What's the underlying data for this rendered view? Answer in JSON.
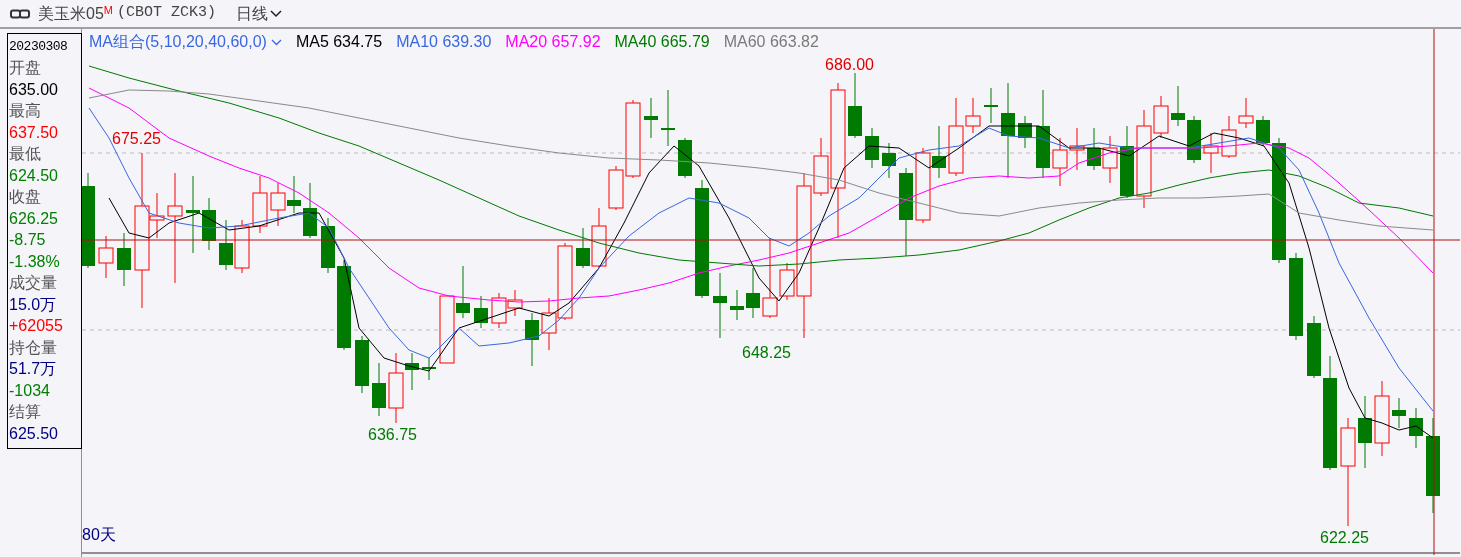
{
  "header": {
    "title": "美玉米05",
    "title_mark": "M",
    "code": "(CBOT ZCK3)",
    "period": "日线"
  },
  "info_panel": {
    "date": "20230308",
    "items": [
      {
        "kind": "label",
        "text": "开盘"
      },
      {
        "kind": "value",
        "text": "635.00",
        "color": "#000000"
      },
      {
        "kind": "label",
        "text": "最高"
      },
      {
        "kind": "value",
        "text": "637.50",
        "color": "#ff0000"
      },
      {
        "kind": "label",
        "text": "最低"
      },
      {
        "kind": "value",
        "text": "624.50",
        "color": "#008000"
      },
      {
        "kind": "label",
        "text": "收盘"
      },
      {
        "kind": "value",
        "text": "626.25",
        "color": "#008000"
      },
      {
        "kind": "value",
        "text": "-8.75",
        "color": "#008000"
      },
      {
        "kind": "value",
        "text": "-1.38%",
        "color": "#008000"
      },
      {
        "kind": "label",
        "text": "成交量"
      },
      {
        "kind": "value",
        "text": "15.0万",
        "color": "#000080"
      },
      {
        "kind": "value",
        "text": "+62055",
        "color": "#ff0000"
      },
      {
        "kind": "label",
        "text": "持仓量"
      },
      {
        "kind": "value",
        "text": "51.7万",
        "color": "#000080"
      },
      {
        "kind": "value",
        "text": "-1034",
        "color": "#008000"
      },
      {
        "kind": "label",
        "text": "结算"
      },
      {
        "kind": "value",
        "text": "625.50",
        "color": "#000080"
      }
    ]
  },
  "indicator_bar": {
    "name": "MA组合(5,10,20,40,60,0)",
    "lines": [
      {
        "label": "MA5 634.75",
        "color": "#000000"
      },
      {
        "label": "MA10 639.30",
        "color": "#3a67e0"
      },
      {
        "label": "MA20 657.92",
        "color": "#ff00ff"
      },
      {
        "label": "MA40 665.79",
        "color": "#007a00"
      },
      {
        "label": "MA60 663.82",
        "color": "#7a7a7a"
      }
    ]
  },
  "chart": {
    "price_labels": [
      {
        "text": "675.25",
        "color": "#e00000"
      },
      {
        "text": "686.00",
        "color": "#e00000"
      },
      {
        "text": "636.75",
        "color": "#007a00"
      },
      {
        "text": "648.25",
        "color": "#007a00"
      },
      {
        "text": "622.25",
        "color": "#007a00"
      }
    ],
    "range": "80天"
  }
}
